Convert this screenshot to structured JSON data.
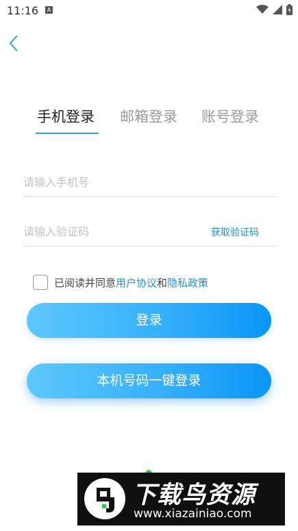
{
  "status_bar": {
    "time": "11:16",
    "badge": "A"
  },
  "tabs": [
    {
      "label": "手机登录",
      "active": true
    },
    {
      "label": "邮箱登录",
      "active": false
    },
    {
      "label": "账号登录",
      "active": false
    }
  ],
  "form": {
    "phone_placeholder": "请输入手机号",
    "code_placeholder": "请输入验证码",
    "get_code_label": "获取验证码"
  },
  "agreement": {
    "prefix": "已阅读并同意",
    "user_agreement": "用户协议",
    "connector": "和",
    "privacy_policy": "隐私政策"
  },
  "buttons": {
    "login": "登录",
    "one_click_login": "本机号码一键登录"
  },
  "watermark": {
    "title": "下载鸟资源",
    "url": "www.xiazainiao.com"
  },
  "colors": {
    "accent": "#1e8fe8",
    "button_start": "#5ec8fb",
    "button_end": "#0a95f7"
  },
  "icons": [
    "back-arrow-icon",
    "wifi-icon",
    "signal-icon",
    "battery-icon",
    "checkbox-icon"
  ]
}
